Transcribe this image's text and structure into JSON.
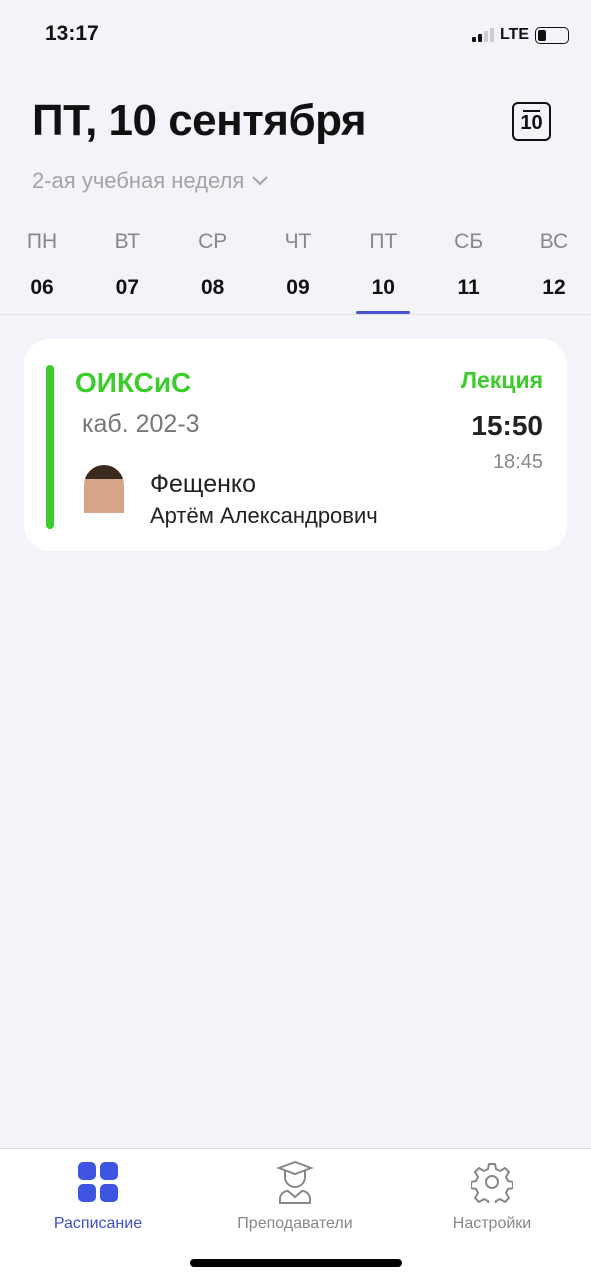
{
  "status": {
    "time": "13:17",
    "network": "LTE"
  },
  "header": {
    "title": "ПТ, 10 сентября",
    "calendar_icon_day": "10",
    "week": "2-ая учебная неделя"
  },
  "days": [
    {
      "name": "ПН",
      "num": "06"
    },
    {
      "name": "ВТ",
      "num": "07"
    },
    {
      "name": "СР",
      "num": "08"
    },
    {
      "name": "ЧТ",
      "num": "09"
    },
    {
      "name": "ПТ",
      "num": "10"
    },
    {
      "name": "СБ",
      "num": "11"
    },
    {
      "name": "ВС",
      "num": "12"
    }
  ],
  "lesson": {
    "subject": "ОИКСиС",
    "type": "Лекция",
    "room": "каб. 202-3",
    "start": "15:50",
    "end": "18:45",
    "teacher_last": "Фещенко",
    "teacher_name": "Артём Александрович",
    "accent": "#3ccc2c"
  },
  "tabs": [
    {
      "label": "Расписание"
    },
    {
      "label": "Преподаватели"
    },
    {
      "label": "Настройки"
    }
  ]
}
